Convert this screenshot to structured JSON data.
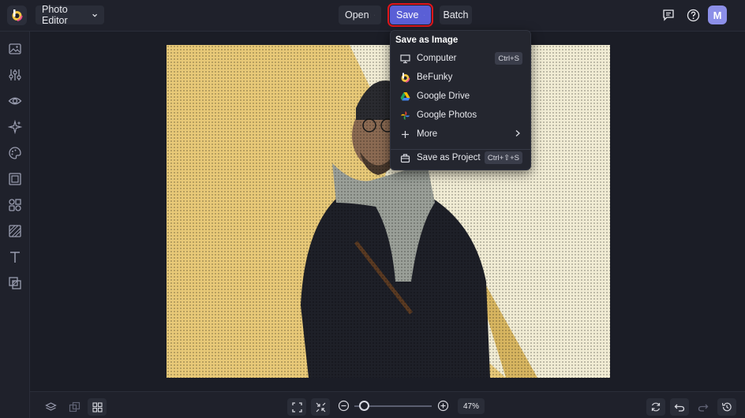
{
  "topbar": {
    "app_menu_label": "Photo Editor",
    "open_label": "Open",
    "save_label": "Save",
    "batch_label": "Batch",
    "avatar_initial": "M"
  },
  "save_menu": {
    "heading": "Save as Image",
    "items": [
      {
        "label": "Computer",
        "icon": "monitor-icon",
        "shortcut": "Ctrl+S"
      },
      {
        "label": "BeFunky",
        "icon": "befunky-icon",
        "shortcut": ""
      },
      {
        "label": "Google Drive",
        "icon": "google-drive-icon",
        "shortcut": ""
      },
      {
        "label": "Google Photos",
        "icon": "google-photos-icon",
        "shortcut": ""
      },
      {
        "label": "More",
        "icon": "plus-icon",
        "shortcut": ""
      }
    ],
    "project_item": {
      "label": "Save as Project",
      "icon": "briefcase-icon",
      "shortcut": "Ctrl+⇧+S"
    }
  },
  "sidebar": {
    "items": [
      "image-icon",
      "sliders-icon",
      "eye-icon",
      "sparkles-icon",
      "palette-icon",
      "frame-icon",
      "graphics-icon",
      "texture-icon",
      "text-icon",
      "overlay-icon"
    ]
  },
  "bottombar": {
    "zoom_label": "47%"
  },
  "colors": {
    "accent": "#5a5fd6",
    "highlight": "#e0151b",
    "background": "#1b1d26",
    "panel": "#1f212b"
  }
}
